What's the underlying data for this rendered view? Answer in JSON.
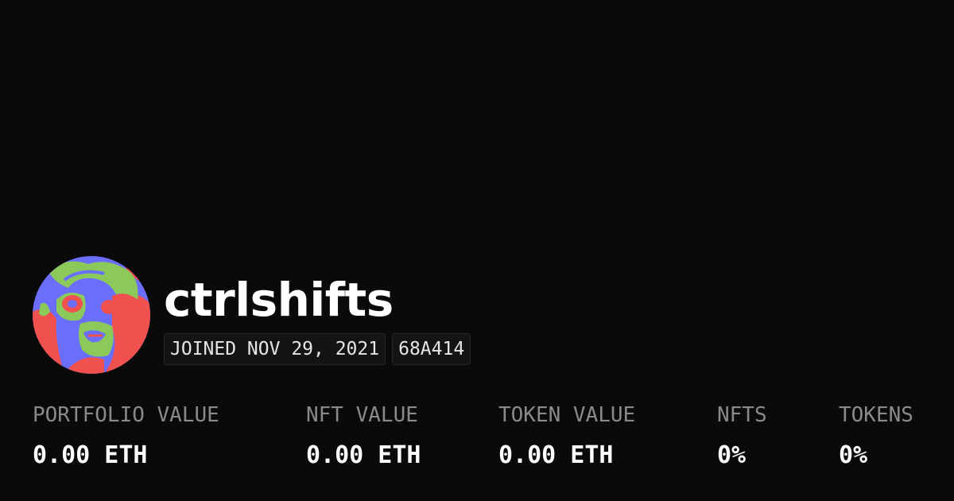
{
  "profile": {
    "username": "ctrlshifts",
    "joined": "JOINED NOV 29, 2021",
    "address_tag": "68A414"
  },
  "stats": [
    {
      "label": "PORTFOLIO VALUE",
      "value": "0.00 ETH"
    },
    {
      "label": "NFT VALUE",
      "value": "0.00 ETH"
    },
    {
      "label": "TOKEN VALUE",
      "value": "0.00 ETH"
    },
    {
      "label": "NFTS",
      "value": "0%"
    },
    {
      "label": "TOKENS",
      "value": "0%"
    }
  ],
  "colors": {
    "background": "#0a0a0a",
    "text_primary": "#ffffff",
    "text_secondary": "#8a8a8a",
    "badge_bg": "#141414",
    "avatar_red": "#f0514f",
    "avatar_blue": "#6b6dfc",
    "avatar_green": "#8ac95a"
  }
}
